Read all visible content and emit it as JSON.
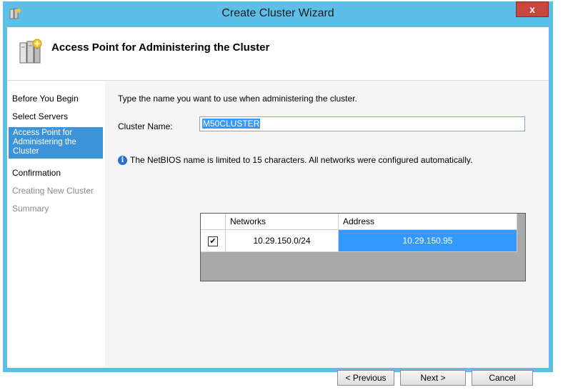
{
  "window": {
    "title": "Create Cluster Wizard",
    "close_label": "x"
  },
  "header": {
    "title": "Access Point for Administering the Cluster"
  },
  "nav": {
    "items": [
      {
        "label": "Before You Begin",
        "state": "normal"
      },
      {
        "label": "Select Servers",
        "state": "normal"
      },
      {
        "label": "Access Point for Administering the Cluster",
        "state": "active"
      },
      {
        "label": "Confirmation",
        "state": "normal"
      },
      {
        "label": "Creating New Cluster",
        "state": "disabled"
      },
      {
        "label": "Summary",
        "state": "disabled"
      }
    ]
  },
  "main": {
    "intro": "Type the name you want to use when administering the cluster.",
    "cluster_name_label": "Cluster Name:",
    "cluster_name_value": "M50CLUSTER",
    "info_text": "The NetBIOS name is limited to 15 characters.  All networks were configured automatically.",
    "info_icon": "i",
    "networks_table": {
      "columns": [
        "Networks",
        "Address"
      ],
      "rows": [
        {
          "checked": true,
          "network": "10.29.150.0/24",
          "address": "10.29.150.95"
        }
      ]
    }
  },
  "buttons": {
    "previous": "< Previous",
    "next": "Next >",
    "cancel": "Cancel"
  }
}
